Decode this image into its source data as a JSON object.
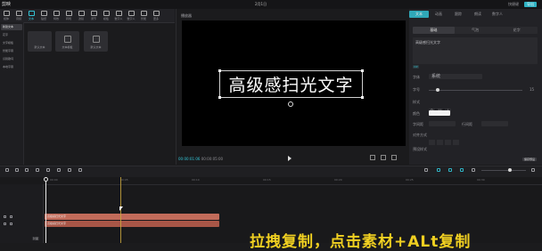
{
  "app": {
    "logo": "剪映",
    "project_title": "2月1日",
    "export_label": "导出"
  },
  "topbar_right": [
    "快捷键",
    "剪映"
  ],
  "media_tabs": [
    {
      "label": "媒体",
      "active": false
    },
    {
      "label": "音频",
      "active": false
    },
    {
      "label": "文本",
      "active": true
    },
    {
      "label": "贴纸",
      "active": false
    },
    {
      "label": "特效",
      "active": false
    },
    {
      "label": "转场",
      "active": false
    },
    {
      "label": "滤镜",
      "active": false
    },
    {
      "label": "调节",
      "active": false
    },
    {
      "label": "模板",
      "active": false
    },
    {
      "label": "数字人",
      "active": false
    },
    {
      "label": "数字人",
      "active": false
    },
    {
      "label": "智能",
      "active": false
    },
    {
      "label": "更多",
      "active": false
    }
  ],
  "categories": [
    {
      "label": "新建文本",
      "active": true
    },
    {
      "label": "花字",
      "active": false
    },
    {
      "label": "文字模板",
      "active": false
    },
    {
      "label": "智能字幕",
      "active": false
    },
    {
      "label": "识别歌词",
      "active": false
    },
    {
      "label": "本地字幕",
      "active": false
    }
  ],
  "text_cards": [
    "默认文本",
    "文本模板",
    "默认文本"
  ],
  "player": {
    "title": "播放器",
    "caption": "高级感扫光文字",
    "time_current": "00:00:01:06",
    "time_total": "00:00:05:00"
  },
  "right_panel": {
    "tabs": [
      {
        "label": "文本",
        "active": true
      },
      {
        "label": "动画",
        "active": false
      },
      {
        "label": "跟踪",
        "active": false
      },
      {
        "label": "朗读",
        "active": false
      },
      {
        "label": "数字人",
        "active": false
      }
    ],
    "subtabs": [
      {
        "label": "基础",
        "active": true
      },
      {
        "label": "气泡",
        "active": false
      },
      {
        "label": "花字",
        "active": false
      }
    ],
    "text_value": "高级感扫光文字",
    "font_label": "字体",
    "font_value": "系统",
    "size_label": "字号",
    "size_value": "15",
    "style_label": "样式",
    "color_label": "颜色",
    "spacing_label": "字间距",
    "line_label": "行间距",
    "align_label": "对齐方式",
    "preset_label": "预设样式",
    "save_preset": "保存预设",
    "badge": "VIP"
  },
  "timeline": {
    "ruler_labels": [
      "00:00",
      "00:05",
      "00:10",
      "00:15",
      "00:20",
      "00:25",
      "00:30"
    ],
    "clip1_label": "高级感扫光文字",
    "clip2_label": "高级感扫光文字",
    "cover_label": "封面"
  },
  "subtitle_overlay": "拉拽复制，点击素材+ALt复制"
}
